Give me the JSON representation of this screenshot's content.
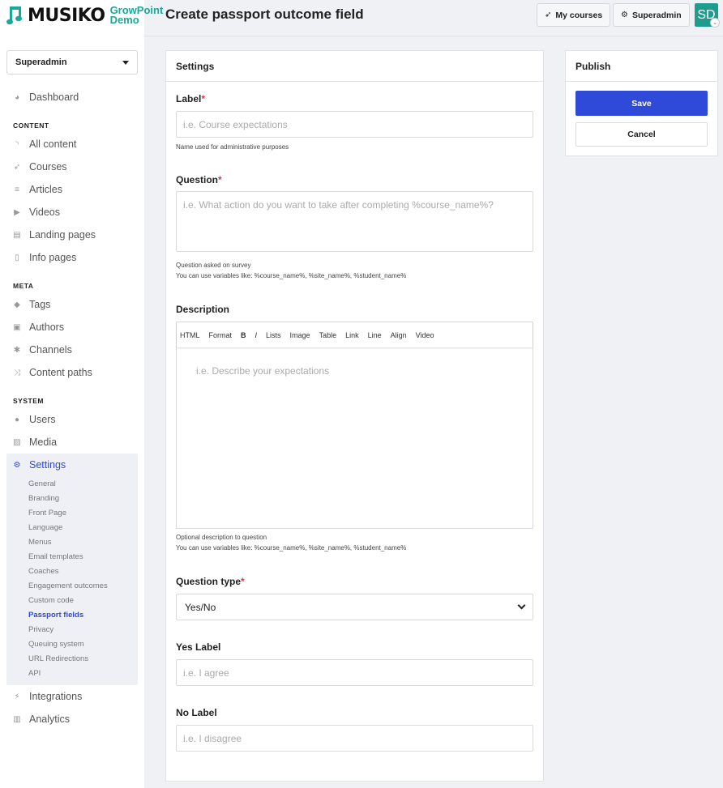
{
  "brand": {
    "name": "MUSIKO",
    "sub1": "GrowPoint",
    "sub2": "Demo"
  },
  "role_selector": {
    "value": "Superadmin"
  },
  "nav": {
    "dashboard": "Dashboard",
    "content_heading": "CONTENT",
    "content": [
      "All content",
      "Courses",
      "Articles",
      "Videos",
      "Landing pages",
      "Info pages"
    ],
    "meta_heading": "META",
    "meta": [
      "Tags",
      "Authors",
      "Channels",
      "Content paths"
    ],
    "system_heading": "SYSTEM",
    "users": "Users",
    "media": "Media",
    "settings": "Settings",
    "settings_sub": [
      "General",
      "Branding",
      "Front Page",
      "Language",
      "Menus",
      "Email templates",
      "Coaches",
      "Engagement outcomes",
      "Custom code",
      "Passport fields",
      "Privacy",
      "Queuing system",
      "URL Redirections",
      "API"
    ],
    "integrations": "Integrations",
    "analytics": "Analytics"
  },
  "header": {
    "title": "Create passport outcome field",
    "my_courses": "My courses",
    "superadmin": "Superadmin",
    "avatar_initials": "SD"
  },
  "settings_panel": {
    "title": "Settings",
    "label": {
      "label": "Label",
      "required": "*",
      "placeholder": "i.e. Course expectations",
      "help": "Name used for administrative purposes"
    },
    "question": {
      "label": "Question",
      "required": "*",
      "placeholder": "i.e. What action do you want to take after completing %course_name%?",
      "help1": "Question asked on survey",
      "help2": "You can use variables like: %course_name%, %site_name%, %student_name%"
    },
    "description": {
      "label": "Description",
      "toolbar": [
        "HTML",
        "Format",
        "B",
        "I",
        "Lists",
        "Image",
        "Table",
        "Link",
        "Line",
        "Align",
        "Video"
      ],
      "placeholder": "i.e. Describe your expectations",
      "help1": "Optional description to question",
      "help2": "You can use variables like: %course_name%, %site_name%, %student_name%"
    },
    "question_type": {
      "label": "Question type",
      "required": "*",
      "value": "Yes/No"
    },
    "yes_label": {
      "label": "Yes Label",
      "placeholder": "i.e. I agree"
    },
    "no_label": {
      "label": "No Label",
      "placeholder": "i.e. I disagree"
    }
  },
  "publish_panel": {
    "title": "Publish",
    "save": "Save",
    "cancel": "Cancel"
  },
  "colors": {
    "accent": "#2f4ad8",
    "brand": "#1aa89a",
    "required": "#d9364a",
    "avatar": "#1e9c8e"
  }
}
